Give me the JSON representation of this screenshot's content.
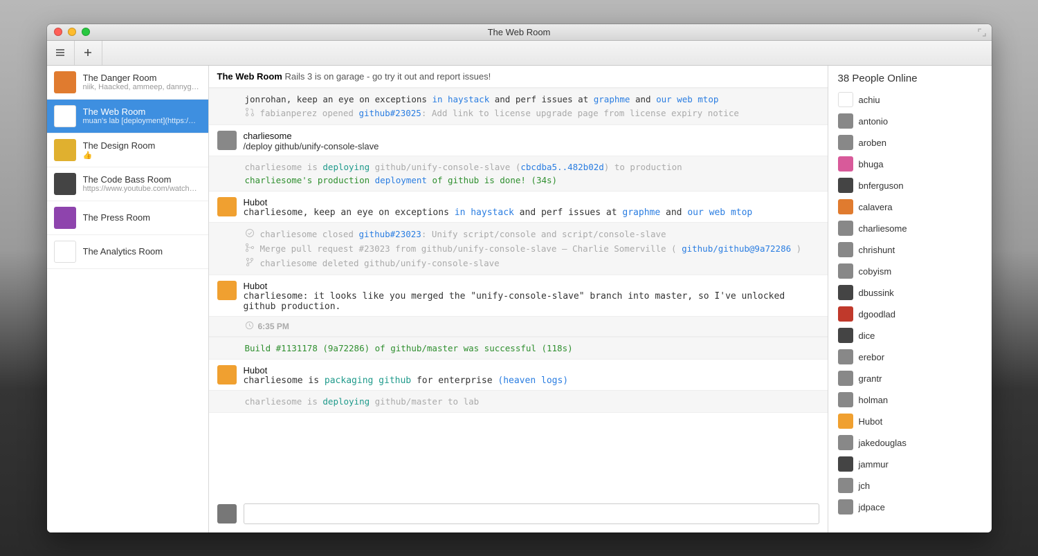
{
  "window": {
    "title": "The Web Room"
  },
  "toolbar": {
    "menu_label": "menu",
    "add_label": "add"
  },
  "rooms": [
    {
      "name": "The Danger Room",
      "sub": "niik, Haacked, ammeep, dannyg…",
      "avatar": "av-orange"
    },
    {
      "name": "The Web Room",
      "sub": "muan's lab [deployment](https:/…",
      "avatar": "av-white",
      "active": true
    },
    {
      "name": "The Design Room",
      "sub": "👍",
      "avatar": "av-yellow"
    },
    {
      "name": "The Code Bass Room",
      "sub": "https://www.youtube.com/watch…",
      "avatar": "av-dark"
    },
    {
      "name": "The Press Room",
      "sub": "",
      "avatar": "av-purple"
    },
    {
      "name": "The Analytics Room",
      "sub": "",
      "avatar": "av-white"
    }
  ],
  "topic": {
    "room": "The Web Room",
    "text": "Rails 3 is on garage - go try it out and report issues!"
  },
  "stream": {
    "pre_line": {
      "prefix": "jonrohan, keep an eye on exceptions ",
      "link1": "in haystack",
      "mid1": " and perf issues at ",
      "link2": "graphme",
      "mid2": " and ",
      "link3": "our web mtop"
    },
    "pr_open": {
      "prefix": "fabianperez opened ",
      "link": "github#23025",
      "suffix": ": Add link to license upgrade page from license expiry notice"
    },
    "msg_charlie": {
      "who": "charliesome",
      "body": "/deploy github/unify-console-slave"
    },
    "deploying": {
      "p1": "charliesome is ",
      "kw": "deploying",
      "p2": " github/unify-console-slave (",
      "sha": "cbcdba5..482b02d",
      "p3": ") to production"
    },
    "deploy_done": {
      "p1": "charliesome's production ",
      "kw": "deployment",
      "p2": " of github is done! (34s)"
    },
    "msg_hubot1": {
      "who": "Hubot",
      "p1": "charliesome, keep an eye on exceptions ",
      "l1": "in haystack",
      "p2": " and perf issues at ",
      "l2": "graphme",
      "p3": " and ",
      "l3": "our web mtop"
    },
    "closed": {
      "prefix": "charliesome closed ",
      "link": "github#23023",
      "suffix": ": Unify script/console and script/console-slave"
    },
    "merge": {
      "prefix": "Merge pull request #23023 from github/unify-console-slave – Charlie Somerville ( ",
      "link": "github/github@9a72286",
      "suffix": " )"
    },
    "deleted": "charliesome deleted github/unify-console-slave",
    "msg_hubot2": {
      "who": "Hubot",
      "body": "charliesome: it looks like you merged the \"unify-console-slave\" branch into master, so I've unlocked github production."
    },
    "time": "6:35 PM",
    "build_ok": "Build #1131178 (9a72286) of github/master was successful (118s)",
    "msg_hubot3": {
      "who": "Hubot",
      "p1": "charliesome is ",
      "kw": "packaging github",
      "p2": " for enterprise ",
      "l1": "(heaven logs)"
    },
    "deploying2": {
      "p1": "charliesome is ",
      "kw": "deploying",
      "p2": " github/master to lab"
    }
  },
  "people": {
    "header": "38 People Online",
    "list": [
      {
        "name": "achiu",
        "c": "av-white"
      },
      {
        "name": "antonio",
        "c": "av-grey"
      },
      {
        "name": "aroben",
        "c": "av-grey"
      },
      {
        "name": "bhuga",
        "c": "av-pink"
      },
      {
        "name": "bnferguson",
        "c": "av-dark"
      },
      {
        "name": "calavera",
        "c": "av-orange"
      },
      {
        "name": "charliesome",
        "c": "av-grey"
      },
      {
        "name": "chrishunt",
        "c": "av-grey"
      },
      {
        "name": "cobyism",
        "c": "av-grey"
      },
      {
        "name": "dbussink",
        "c": "av-dark"
      },
      {
        "name": "dgoodlad",
        "c": "av-red"
      },
      {
        "name": "dice",
        "c": "av-dark"
      },
      {
        "name": "erebor",
        "c": "av-grey"
      },
      {
        "name": "grantr",
        "c": "av-grey"
      },
      {
        "name": "holman",
        "c": "av-grey"
      },
      {
        "name": "Hubot",
        "c": "av-hubot"
      },
      {
        "name": "jakedouglas",
        "c": "av-grey"
      },
      {
        "name": "jammur",
        "c": "av-dark"
      },
      {
        "name": "jch",
        "c": "av-grey"
      },
      {
        "name": "jdpace",
        "c": "av-grey"
      }
    ]
  },
  "composer": {
    "placeholder": ""
  }
}
